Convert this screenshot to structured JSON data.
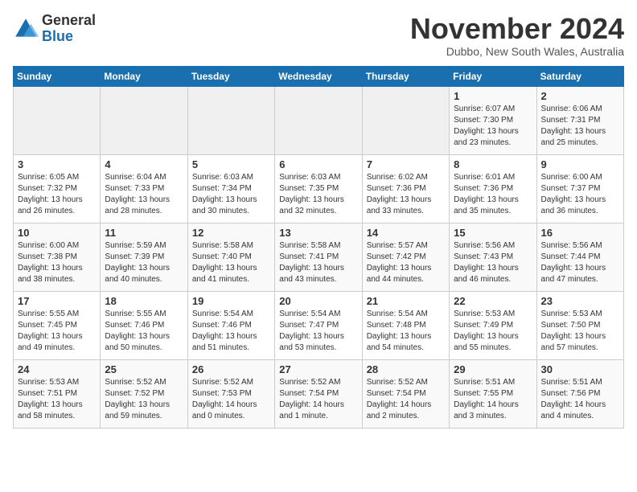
{
  "logo": {
    "general": "General",
    "blue": "Blue"
  },
  "title": "November 2024",
  "subtitle": "Dubbo, New South Wales, Australia",
  "days_of_week": [
    "Sunday",
    "Monday",
    "Tuesday",
    "Wednesday",
    "Thursday",
    "Friday",
    "Saturday"
  ],
  "weeks": [
    [
      {
        "day": "",
        "info": ""
      },
      {
        "day": "",
        "info": ""
      },
      {
        "day": "",
        "info": ""
      },
      {
        "day": "",
        "info": ""
      },
      {
        "day": "",
        "info": ""
      },
      {
        "day": "1",
        "info": "Sunrise: 6:07 AM\nSunset: 7:30 PM\nDaylight: 13 hours\nand 23 minutes."
      },
      {
        "day": "2",
        "info": "Sunrise: 6:06 AM\nSunset: 7:31 PM\nDaylight: 13 hours\nand 25 minutes."
      }
    ],
    [
      {
        "day": "3",
        "info": "Sunrise: 6:05 AM\nSunset: 7:32 PM\nDaylight: 13 hours\nand 26 minutes."
      },
      {
        "day": "4",
        "info": "Sunrise: 6:04 AM\nSunset: 7:33 PM\nDaylight: 13 hours\nand 28 minutes."
      },
      {
        "day": "5",
        "info": "Sunrise: 6:03 AM\nSunset: 7:34 PM\nDaylight: 13 hours\nand 30 minutes."
      },
      {
        "day": "6",
        "info": "Sunrise: 6:03 AM\nSunset: 7:35 PM\nDaylight: 13 hours\nand 32 minutes."
      },
      {
        "day": "7",
        "info": "Sunrise: 6:02 AM\nSunset: 7:36 PM\nDaylight: 13 hours\nand 33 minutes."
      },
      {
        "day": "8",
        "info": "Sunrise: 6:01 AM\nSunset: 7:36 PM\nDaylight: 13 hours\nand 35 minutes."
      },
      {
        "day": "9",
        "info": "Sunrise: 6:00 AM\nSunset: 7:37 PM\nDaylight: 13 hours\nand 36 minutes."
      }
    ],
    [
      {
        "day": "10",
        "info": "Sunrise: 6:00 AM\nSunset: 7:38 PM\nDaylight: 13 hours\nand 38 minutes."
      },
      {
        "day": "11",
        "info": "Sunrise: 5:59 AM\nSunset: 7:39 PM\nDaylight: 13 hours\nand 40 minutes."
      },
      {
        "day": "12",
        "info": "Sunrise: 5:58 AM\nSunset: 7:40 PM\nDaylight: 13 hours\nand 41 minutes."
      },
      {
        "day": "13",
        "info": "Sunrise: 5:58 AM\nSunset: 7:41 PM\nDaylight: 13 hours\nand 43 minutes."
      },
      {
        "day": "14",
        "info": "Sunrise: 5:57 AM\nSunset: 7:42 PM\nDaylight: 13 hours\nand 44 minutes."
      },
      {
        "day": "15",
        "info": "Sunrise: 5:56 AM\nSunset: 7:43 PM\nDaylight: 13 hours\nand 46 minutes."
      },
      {
        "day": "16",
        "info": "Sunrise: 5:56 AM\nSunset: 7:44 PM\nDaylight: 13 hours\nand 47 minutes."
      }
    ],
    [
      {
        "day": "17",
        "info": "Sunrise: 5:55 AM\nSunset: 7:45 PM\nDaylight: 13 hours\nand 49 minutes."
      },
      {
        "day": "18",
        "info": "Sunrise: 5:55 AM\nSunset: 7:46 PM\nDaylight: 13 hours\nand 50 minutes."
      },
      {
        "day": "19",
        "info": "Sunrise: 5:54 AM\nSunset: 7:46 PM\nDaylight: 13 hours\nand 51 minutes."
      },
      {
        "day": "20",
        "info": "Sunrise: 5:54 AM\nSunset: 7:47 PM\nDaylight: 13 hours\nand 53 minutes."
      },
      {
        "day": "21",
        "info": "Sunrise: 5:54 AM\nSunset: 7:48 PM\nDaylight: 13 hours\nand 54 minutes."
      },
      {
        "day": "22",
        "info": "Sunrise: 5:53 AM\nSunset: 7:49 PM\nDaylight: 13 hours\nand 55 minutes."
      },
      {
        "day": "23",
        "info": "Sunrise: 5:53 AM\nSunset: 7:50 PM\nDaylight: 13 hours\nand 57 minutes."
      }
    ],
    [
      {
        "day": "24",
        "info": "Sunrise: 5:53 AM\nSunset: 7:51 PM\nDaylight: 13 hours\nand 58 minutes."
      },
      {
        "day": "25",
        "info": "Sunrise: 5:52 AM\nSunset: 7:52 PM\nDaylight: 13 hours\nand 59 minutes."
      },
      {
        "day": "26",
        "info": "Sunrise: 5:52 AM\nSunset: 7:53 PM\nDaylight: 14 hours\nand 0 minutes."
      },
      {
        "day": "27",
        "info": "Sunrise: 5:52 AM\nSunset: 7:54 PM\nDaylight: 14 hours\nand 1 minute."
      },
      {
        "day": "28",
        "info": "Sunrise: 5:52 AM\nSunset: 7:54 PM\nDaylight: 14 hours\nand 2 minutes."
      },
      {
        "day": "29",
        "info": "Sunrise: 5:51 AM\nSunset: 7:55 PM\nDaylight: 14 hours\nand 3 minutes."
      },
      {
        "day": "30",
        "info": "Sunrise: 5:51 AM\nSunset: 7:56 PM\nDaylight: 14 hours\nand 4 minutes."
      }
    ]
  ]
}
